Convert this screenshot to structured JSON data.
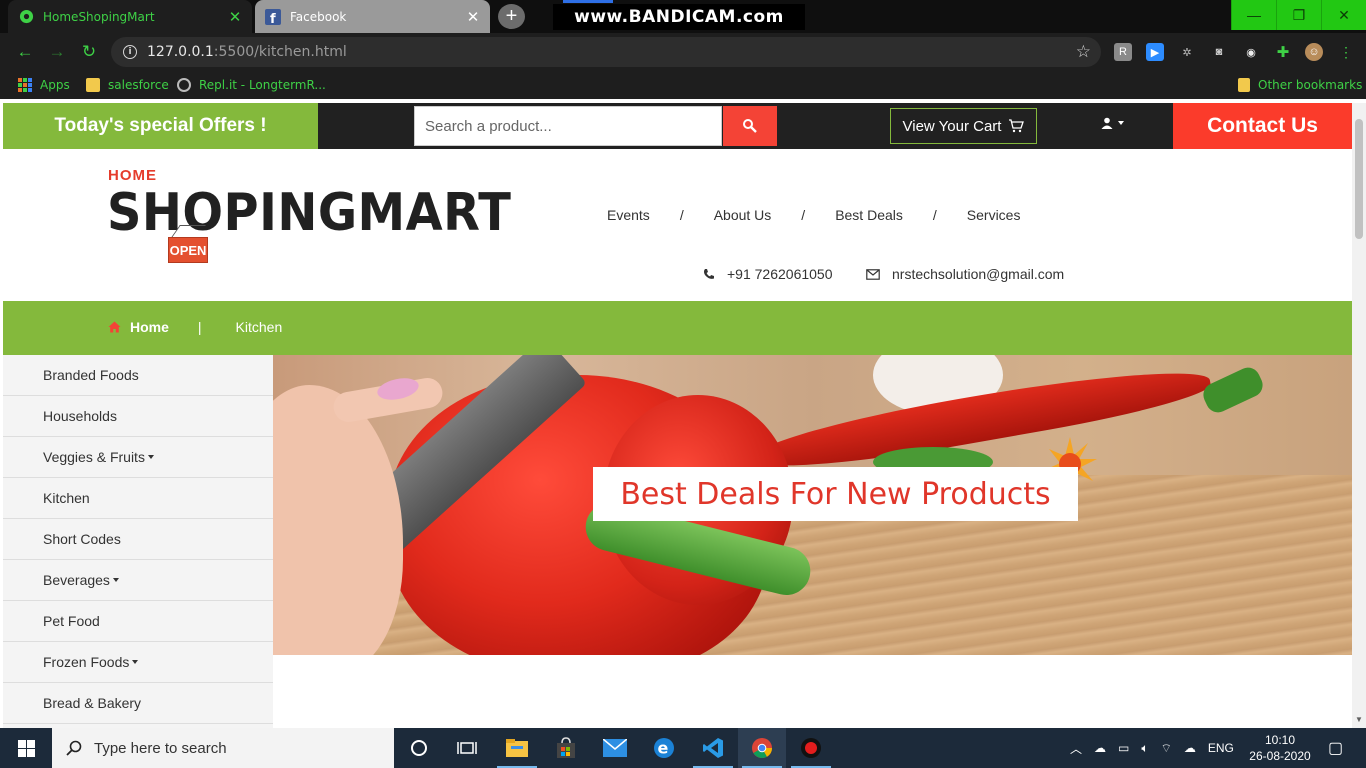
{
  "browser": {
    "tabs": [
      {
        "title": "HomeShopingMart",
        "active": true
      },
      {
        "title": "Facebook",
        "active": false
      }
    ],
    "watermark": "www.BANDICAM.com",
    "url_host": "127.0.0.1",
    "url_path": ":5500/kitchen.html",
    "bookmarks": [
      {
        "label": "Apps"
      },
      {
        "label": "salesforce"
      },
      {
        "label": "Repl.it - LongtermR..."
      }
    ],
    "other_bookmarks": "Other bookmarks",
    "accent_color": "#3ed146"
  },
  "header": {
    "offers": "Today's special Offers !",
    "search_placeholder": "Search a product...",
    "cart": "View Your Cart",
    "contact": "Contact Us"
  },
  "brand": {
    "home": "HOME",
    "name": "SHOPINGMART",
    "sign": "OPEN"
  },
  "nav": {
    "items": [
      "Events",
      "About Us",
      "Best Deals",
      "Services"
    ],
    "separator": "/",
    "phone": "+91 7262061050",
    "email": "nrstechsolution@gmail.com"
  },
  "breadcrumb": {
    "home": "Home",
    "separator": "|",
    "current": "Kitchen"
  },
  "sidebar": {
    "items": [
      {
        "label": "Branded Foods",
        "caret": false
      },
      {
        "label": "Households",
        "caret": false
      },
      {
        "label": "Veggies & Fruits",
        "caret": true
      },
      {
        "label": "Kitchen",
        "caret": false
      },
      {
        "label": "Short Codes",
        "caret": false
      },
      {
        "label": "Beverages",
        "caret": true
      },
      {
        "label": "Pet Food",
        "caret": false
      },
      {
        "label": "Frozen Foods",
        "caret": true
      },
      {
        "label": "Bread & Bakery",
        "caret": false
      }
    ]
  },
  "banner": {
    "headline": "Best Deals For New Products"
  },
  "taskbar": {
    "search_placeholder": "Type here to search",
    "lang": "ENG",
    "time": "10:10",
    "date": "26-08-2020"
  },
  "colors": {
    "brand_green": "#84b93c",
    "brand_red": "#f44336",
    "contact_red": "#fb3b2b",
    "dark": "#212121"
  }
}
